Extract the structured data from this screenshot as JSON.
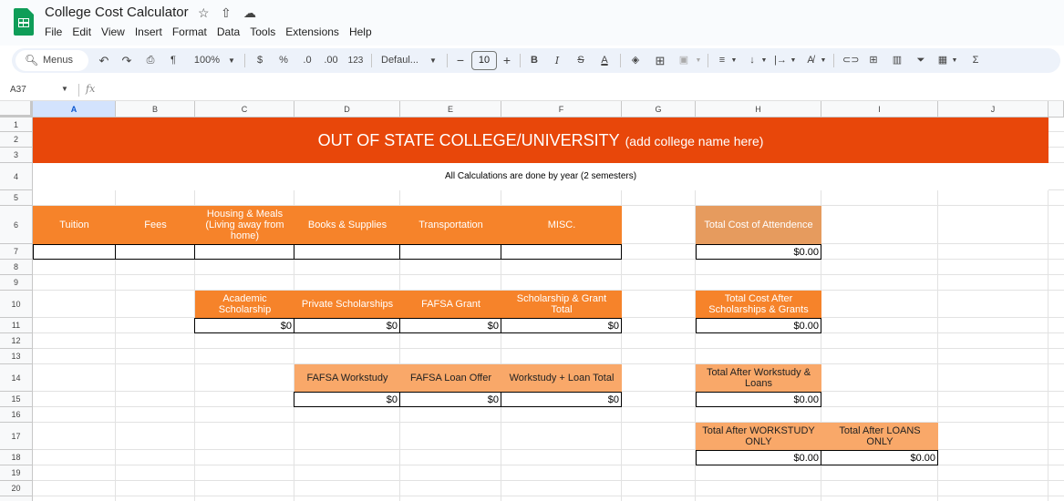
{
  "app": {
    "doc_title": "College Cost Calculator",
    "menu": [
      "File",
      "Edit",
      "View",
      "Insert",
      "Format",
      "Data",
      "Tools",
      "Extensions",
      "Help"
    ]
  },
  "toolbar": {
    "menus_label": "Menus",
    "zoom": "100%",
    "currency": "$",
    "percent": "%",
    "dec_decrease": ".0",
    "dec_increase": ".00",
    "number_format": "123",
    "font": "Defaul...",
    "font_size": "10",
    "bold": "B",
    "italic": "I",
    "strike": "S",
    "text_color": "A"
  },
  "formula_bar": {
    "cell_ref": "A37",
    "fx": "fx"
  },
  "columns": [
    "A",
    "B",
    "C",
    "D",
    "E",
    "F",
    "G",
    "H",
    "I",
    "J"
  ],
  "rows": [
    "1",
    "2",
    "3",
    "4",
    "5",
    "6",
    "7",
    "8",
    "9",
    "10",
    "11",
    "12",
    "13",
    "14",
    "15",
    "16",
    "17",
    "18",
    "19",
    "20"
  ],
  "sheet": {
    "banner_title": "OUT OF STATE COLLEGE/UNIVERSITY",
    "banner_sub": "(add college name here)",
    "note": "All Calculations are done by year (2 semesters)",
    "cost_headers": [
      "Tuition",
      "Fees",
      "Housing & Meals (Living away from home)",
      "Books & Supplies",
      "Transportation",
      "MISC."
    ],
    "total_cost_label": "Total Cost of Attendence",
    "total_cost_value": "$0.00",
    "aid_headers": [
      "Academic Scholarship",
      "Private Scholarships",
      "FAFSA Grant",
      "Scholarship & Grant Total"
    ],
    "aid_values": [
      "$0",
      "$0",
      "$0",
      "$0"
    ],
    "after_scholarships_label": "Total Cost After Scholarships & Grants",
    "after_scholarships_value": "$0.00",
    "loan_headers": [
      "FAFSA Workstudy",
      "FAFSA Loan Offer",
      "Workstudy + Loan Total"
    ],
    "loan_values": [
      "$0",
      "$0",
      "$0"
    ],
    "after_ws_loans_label": "Total After Workstudy & Loans",
    "after_ws_loans_value": "$0.00",
    "after_ws_only_label": "Total After WORKSTUDY ONLY",
    "after_ws_only_value": "$0.00",
    "after_loans_only_label": "Total After LOANS ONLY",
    "after_loans_only_value": "$0.00"
  },
  "colors": {
    "banner": "#e8470a",
    "header_orange": "#f6832a",
    "header_light": "#f9a869",
    "sheets_green": "#0f9d58"
  }
}
